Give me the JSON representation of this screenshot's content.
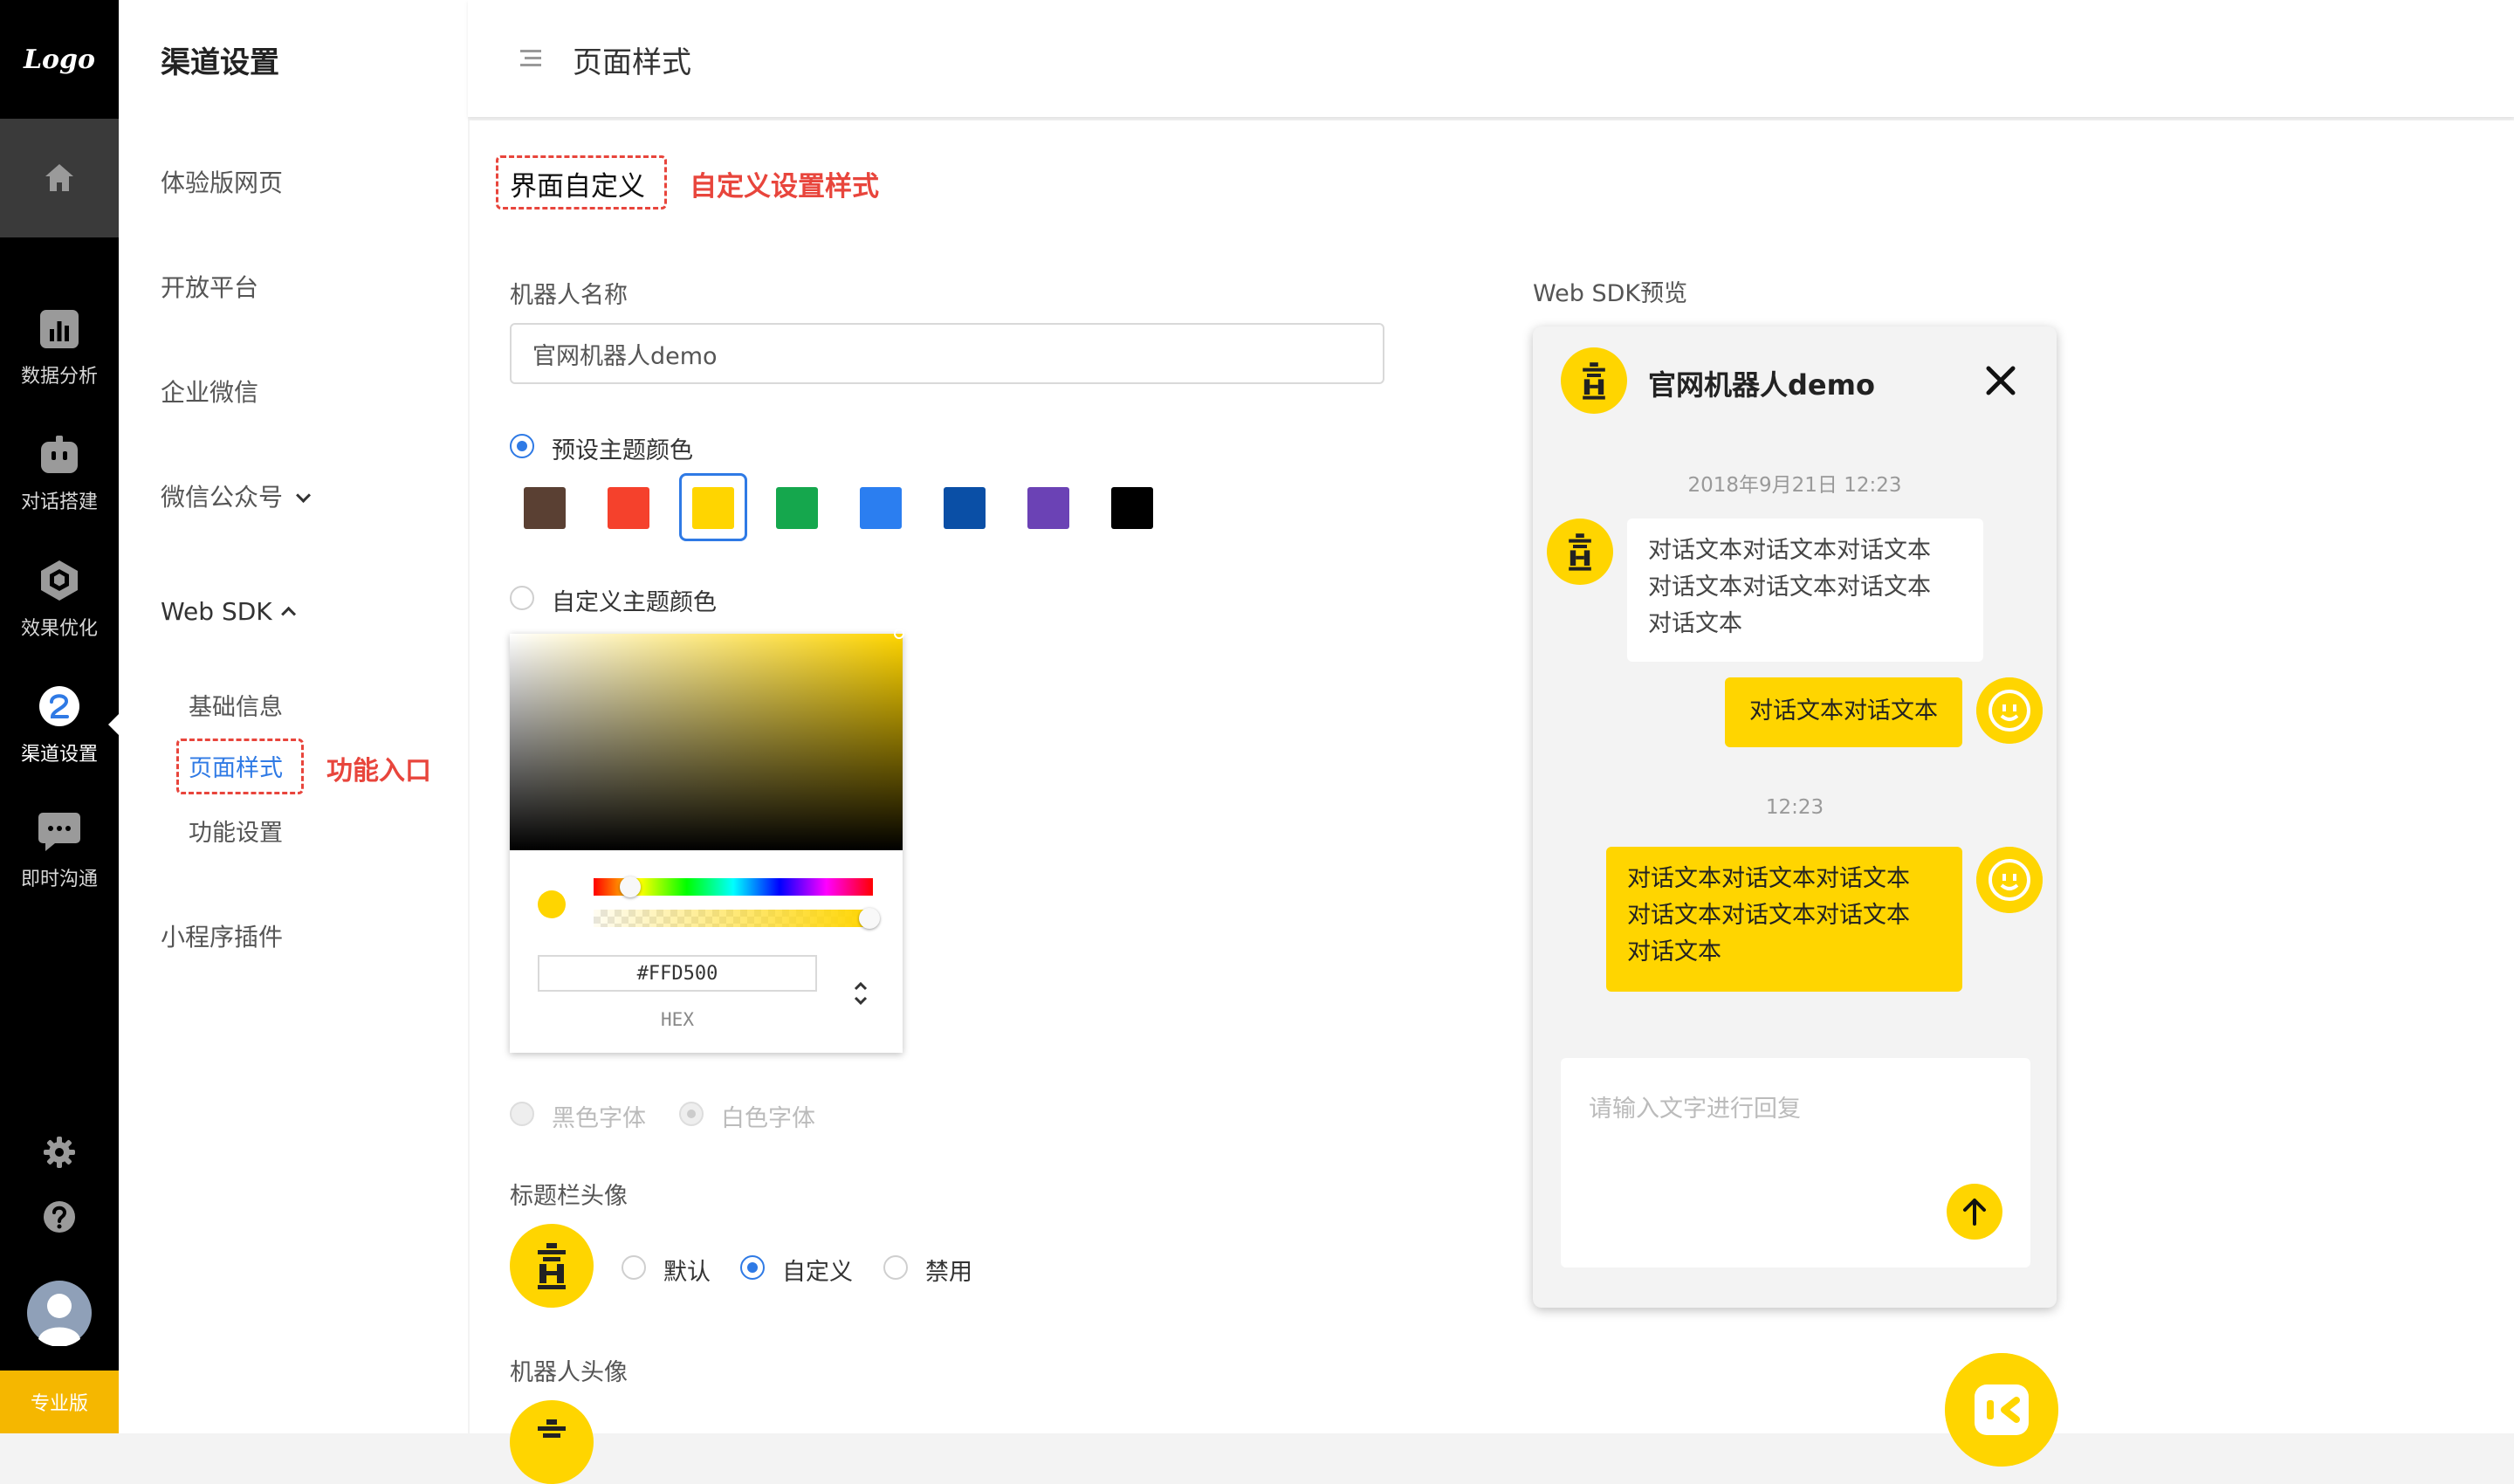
{
  "nav": {
    "logo": "Logo",
    "items": [
      {
        "label": "数据分析",
        "icon": "bar-chart-icon"
      },
      {
        "label": "对话搭建",
        "icon": "robot-icon"
      },
      {
        "label": "效果优化",
        "icon": "cube-icon"
      },
      {
        "label": "渠道设置",
        "icon": "channel-icon",
        "active": true
      },
      {
        "label": "即时沟通",
        "icon": "chat-bubble-icon"
      }
    ],
    "pro_badge": "专业版"
  },
  "sidebar": {
    "title": "渠道设置",
    "items": [
      "体验版网页",
      "开放平台",
      "企业微信",
      "微信公众号",
      "Web SDK",
      "小程序插件"
    ],
    "sub_items": [
      "基础信息",
      "页面样式",
      "功能设置"
    ],
    "annotation": "功能入口"
  },
  "header": {
    "title": "页面样式"
  },
  "main": {
    "section_title": "界面自定义",
    "section_annotation": "自定义设置样式",
    "bot_name_label": "机器人名称",
    "bot_name_value": "官网机器人demo",
    "preset_theme_label": "预设主题颜色",
    "custom_theme_label": "自定义主题颜色",
    "swatches": [
      "#5a4033",
      "#f5412c",
      "#ffd500",
      "#15a74d",
      "#2b7ef0",
      "#0a4fa6",
      "#6b42b5",
      "#000000"
    ],
    "selected_swatch": 2,
    "picker": {
      "hex": "#FFD500",
      "mode": "HEX",
      "alpha": 1.0
    },
    "font_black_label": "黑色字体",
    "font_white_label": "白色字体",
    "title_avatar_label": "标题栏头像",
    "avatar_options": [
      "默认",
      "自定义",
      "禁用"
    ],
    "robot_avatar_label": "机器人头像"
  },
  "preview": {
    "label": "Web SDK预览",
    "title": "官网机器人demo",
    "timestamp1": "2018年9月21日 12:23",
    "bot_message_lines": [
      "对话文本对话文本对话文本",
      "对话文本对话文本对话文本",
      "对话文本"
    ],
    "user_message1": "对话文本对话文本",
    "timestamp2": "12:23",
    "user_message2_lines": [
      "对话文本对话文本对话文本",
      "对话文本对话文本对话文本",
      "对话文本"
    ],
    "input_placeholder": "请输入文字进行回复",
    "accent": "#ffd500"
  }
}
